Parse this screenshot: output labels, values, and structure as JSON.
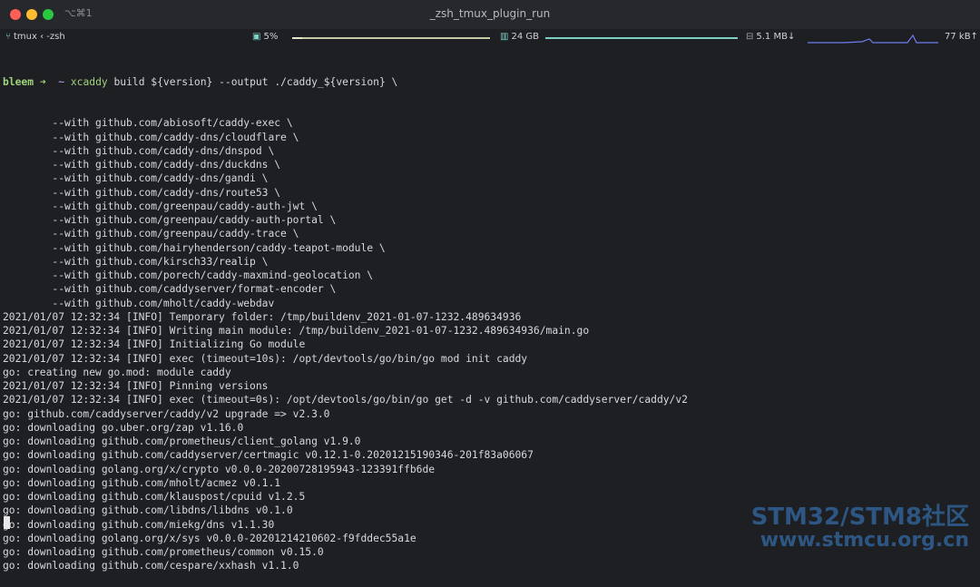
{
  "window": {
    "title": "_zsh_tmux_plugin_run",
    "shortcut": "⌥⌘1",
    "buttons": {
      "close_color": "#fe5f57",
      "minimize_color": "#febc2e",
      "zoom_color": "#28c840"
    }
  },
  "status_bar": {
    "session_icon": "branch-icon",
    "session": "tmux ‹ -zsh",
    "cpu_icon": "cpu-chip-icon",
    "cpu": "5%",
    "cpu_meter": 0.05,
    "mem_icon": "memory-icon",
    "mem": "24 GB",
    "net_down_icon": "network-icon",
    "net_down": "5.1 MB↓",
    "net_up": "77 kB↑"
  },
  "terminal": {
    "prompt_user": "bleem",
    "prompt_arrow": "➜",
    "prompt_dir": "~",
    "command_name": "xcaddy",
    "command_args": " build ${version} --output ./caddy_${version} \\",
    "lines": [
      "        --with github.com/abiosoft/caddy-exec \\",
      "        --with github.com/caddy-dns/cloudflare \\",
      "        --with github.com/caddy-dns/dnspod \\",
      "        --with github.com/caddy-dns/duckdns \\",
      "        --with github.com/caddy-dns/gandi \\",
      "        --with github.com/caddy-dns/route53 \\",
      "        --with github.com/greenpau/caddy-auth-jwt \\",
      "        --with github.com/greenpau/caddy-auth-portal \\",
      "        --with github.com/greenpau/caddy-trace \\",
      "        --with github.com/hairyhenderson/caddy-teapot-module \\",
      "        --with github.com/kirsch33/realip \\",
      "        --with github.com/porech/caddy-maxmind-geolocation \\",
      "        --with github.com/caddyserver/format-encoder \\",
      "        --with github.com/mholt/caddy-webdav",
      "2021/01/07 12:32:34 [INFO] Temporary folder: /tmp/buildenv_2021-01-07-1232.489634936",
      "2021/01/07 12:32:34 [INFO] Writing main module: /tmp/buildenv_2021-01-07-1232.489634936/main.go",
      "2021/01/07 12:32:34 [INFO] Initializing Go module",
      "2021/01/07 12:32:34 [INFO] exec (timeout=10s): /opt/devtools/go/bin/go mod init caddy",
      "go: creating new go.mod: module caddy",
      "2021/01/07 12:32:34 [INFO] Pinning versions",
      "2021/01/07 12:32:34 [INFO] exec (timeout=0s): /opt/devtools/go/bin/go get -d -v github.com/caddyserver/caddy/v2",
      "go: github.com/caddyserver/caddy/v2 upgrade => v2.3.0",
      "go: downloading go.uber.org/zap v1.16.0",
      "go: downloading github.com/prometheus/client_golang v1.9.0",
      "go: downloading github.com/caddyserver/certmagic v0.12.1-0.20201215190346-201f83a06067",
      "go: downloading golang.org/x/crypto v0.0.0-20200728195943-123391ffb6de",
      "go: downloading github.com/mholt/acmez v0.1.1",
      "go: downloading github.com/klauspost/cpuid v1.2.5",
      "go: downloading github.com/libdns/libdns v0.1.0",
      "go: downloading github.com/miekg/dns v1.1.30",
      "go: downloading golang.org/x/sys v0.0.0-20201214210602-f9fddec55a1e",
      "go: downloading github.com/prometheus/common v0.15.0",
      "go: downloading github.com/cespare/xxhash v1.1.0"
    ]
  },
  "watermark": {
    "line1": "STM32/STM8社区",
    "line2": "www.stmcu.org.cn"
  }
}
